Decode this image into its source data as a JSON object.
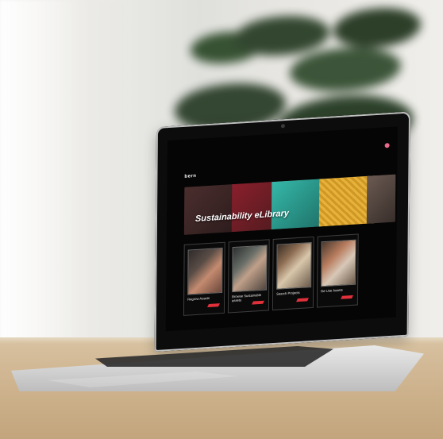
{
  "app": {
    "screen_logo_text": "bern",
    "banner": {
      "title": "Sustainability eLibrary"
    },
    "cards": [
      {
        "label": "Regrow Assets"
      },
      {
        "label": "Browse Sustainable\nassets"
      },
      {
        "label": "Search Projects"
      },
      {
        "label": "Re-Use Assets"
      }
    ]
  },
  "colors": {
    "accent_red": "#E0313B",
    "menu_dot_pink": "#E86A8A"
  },
  "icons": {
    "menu": "menu-dot-icon",
    "card_arrow": "red-arrow-icon"
  }
}
